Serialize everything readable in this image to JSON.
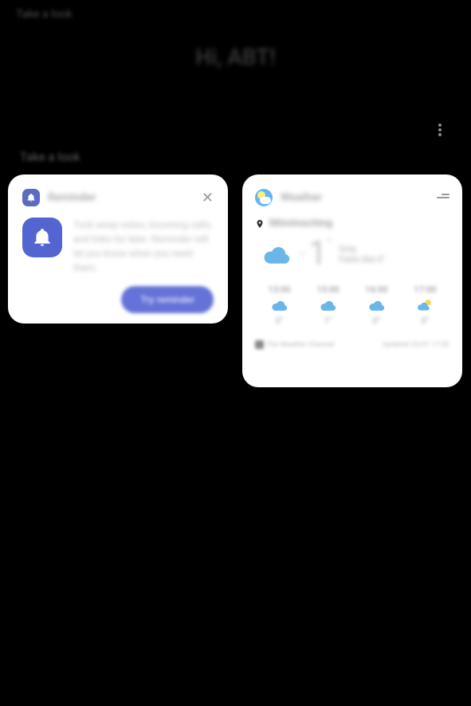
{
  "header": {
    "subtitle_top": "Take a look",
    "greeting": "Hi, ABT!"
  },
  "section": {
    "title": "Take a look"
  },
  "reminder": {
    "title": "Reminder",
    "text": "Tuck away notes, incoming calls, and links for later. Reminder will let you know when you need them.",
    "cta_label": "Try reminder"
  },
  "weather": {
    "title": "Weather",
    "location": "Mönönsching",
    "current": {
      "temp": "1",
      "degree": "°",
      "condition": "Grey",
      "hilo": "Feels like 0°"
    },
    "hourly": [
      {
        "time": "13:00",
        "condition": "cloudy",
        "temp": "0°"
      },
      {
        "time": "15:00",
        "condition": "cloudy",
        "temp": "1°"
      },
      {
        "time": "16:00",
        "condition": "cloudy",
        "temp": "0°"
      },
      {
        "time": "17:00",
        "condition": "night-cloudy",
        "temp": "0°"
      }
    ],
    "provider": "The Weather Channel",
    "updated": "Updated 23/01 17:52"
  }
}
